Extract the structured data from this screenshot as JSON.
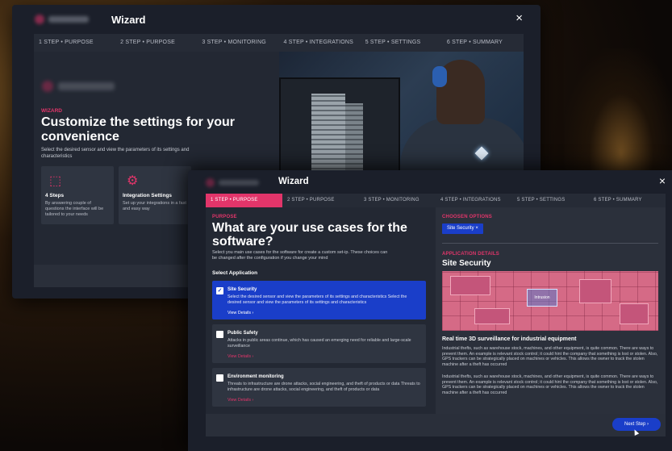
{
  "back_window": {
    "title": "Wizard",
    "close_icon": "×",
    "steps": [
      {
        "label": "1 STEP  •  PURPOSE"
      },
      {
        "label": "2 STEP  •  PURPOSE"
      },
      {
        "label": "3 STEP  •  MONITORING"
      },
      {
        "label": "4 STEP  •  INTEGRATIONS"
      },
      {
        "label": "5 STEP  •  SETTINGS"
      },
      {
        "label": "6 STEP  •  SUMMARY"
      }
    ],
    "kicker": "WIZARD",
    "heading": "Customize the settings for your convenience",
    "description": "Select the desired sensor and view the parameters of its settings and characteristics",
    "cards": [
      {
        "icon": "cursor-click-icon",
        "glyph": "⬚",
        "title": "4 Steps",
        "text": "By answering couple of questions the interface will be tailored to your needs"
      },
      {
        "icon": "gear-icon",
        "glyph": "⚙",
        "title": "Integration Settings",
        "text": "Set up your integrations in a fast and easy way"
      }
    ]
  },
  "front_window": {
    "title": "Wizard",
    "close_icon": "×",
    "steps": [
      {
        "label": "1 STEP  •  PURPOSE",
        "active": true
      },
      {
        "label": "2 STEP  •  PURPOSE"
      },
      {
        "label": "3 STEP  •  MONITORING"
      },
      {
        "label": "4 STEP  •  INTEGRATIONS"
      },
      {
        "label": "5 STEP  •  SETTINGS"
      },
      {
        "label": "6 STEP  •  SUMMARY"
      }
    ],
    "left": {
      "kicker": "PURPOSE",
      "heading": "What are your use cases for the software?",
      "description": "Select you main use cases for the software for create a custom set-ip. These choices can be changed after the configuration if you change your mind",
      "select_label": "Select Application",
      "options": [
        {
          "title": "Site Security",
          "checked": true,
          "check_glyph": "✓",
          "text": "Select the desired sensor and view the parameters of its settings and characteristics Select the desired sensor and view the parameters of its settings and characteristics",
          "link": "View Details  ›"
        },
        {
          "title": "Public Safety",
          "checked": false,
          "check_glyph": "",
          "text": "Attacks in public areas continue, which has caused an emerging need for reliable and large-scale surveillance",
          "link": "View Details  ›"
        },
        {
          "title": "Environment monitoring",
          "checked": false,
          "check_glyph": "",
          "text": "Threats to infrastructure are drone attacks, social engineering, and theft of products or data Threats to infrastructure are drone attacks, social engineering, and theft of products or data",
          "link": "View Details  ›"
        }
      ]
    },
    "right": {
      "chosen_kicker": "CHOOSEN OPTIONS",
      "chip": "Site Security  ×",
      "details_kicker": "APPLICATION DETAILS",
      "site_title": "Site Security",
      "map_label": "Intrusion",
      "subheading": "Real time 3D surveillance for industrial equipment",
      "paragraph1": "Industrial thefts, such as warehouse stock, machines, and other equipment, is quite common. There are ways to prevent them. An example is relevant stock control; it could hint the company that something is lost or stolen. Also, GPS trackers can be strategically placed on machines or vehicles. This allows the owner to track the stolen machine after a theft has occurred",
      "paragraph2": "Industrial thefts, such as warehouse stock, machines, and other equipment, is quite common. There are ways to prevent them. An example is relevant stock control; it could hint the company that something is lost or stolen. Also, GPS trackers can be strategically placed on machines or vehicles. This allows the owner to track the stolen machine after a theft has occurred"
    },
    "next_button": "Next Step  ›"
  },
  "colors": {
    "accent": "#e2356a",
    "primary": "#1a3ec9",
    "panel": "#232833",
    "window": "#1b1f2a"
  }
}
